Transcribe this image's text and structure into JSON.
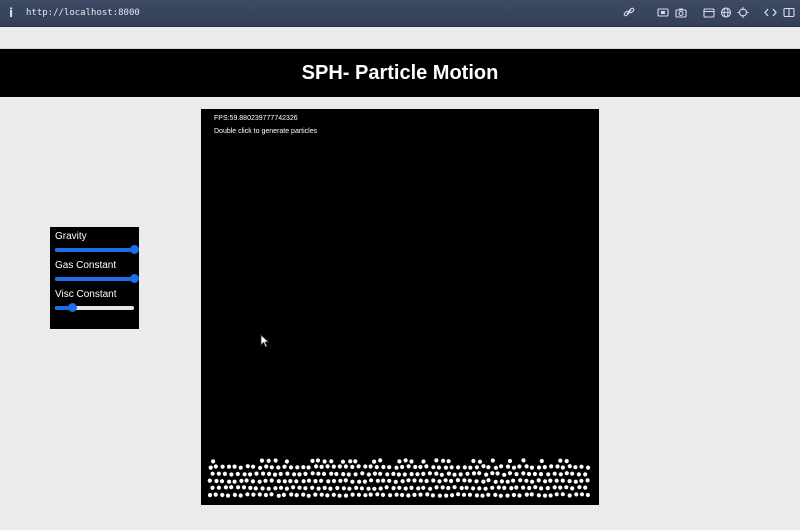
{
  "browser": {
    "url": "http://localhost:8000",
    "info_glyph": "i",
    "toolbar_icons": [
      "link-icon",
      "screen-icon",
      "camera-icon",
      "sidebar-icon",
      "globe-icon",
      "target-icon",
      "code-icon",
      "split-icon"
    ]
  },
  "header": {
    "title": "SPH- Particle Motion"
  },
  "controls": {
    "gravity": {
      "label": "Gravity",
      "value": 1.0
    },
    "gas_constant": {
      "label": "Gas Constant",
      "value": 1.0
    },
    "visc_constant": {
      "label": "Visc Constant",
      "value": 0.22
    }
  },
  "canvas": {
    "fps_text": "FPS:59.880239777742326",
    "hint_text": "Double click to generate particles"
  },
  "colors": {
    "accent": "#1a6fe8",
    "background": "#ebebeb",
    "panel": "#000000",
    "particle": "#ffffff"
  }
}
